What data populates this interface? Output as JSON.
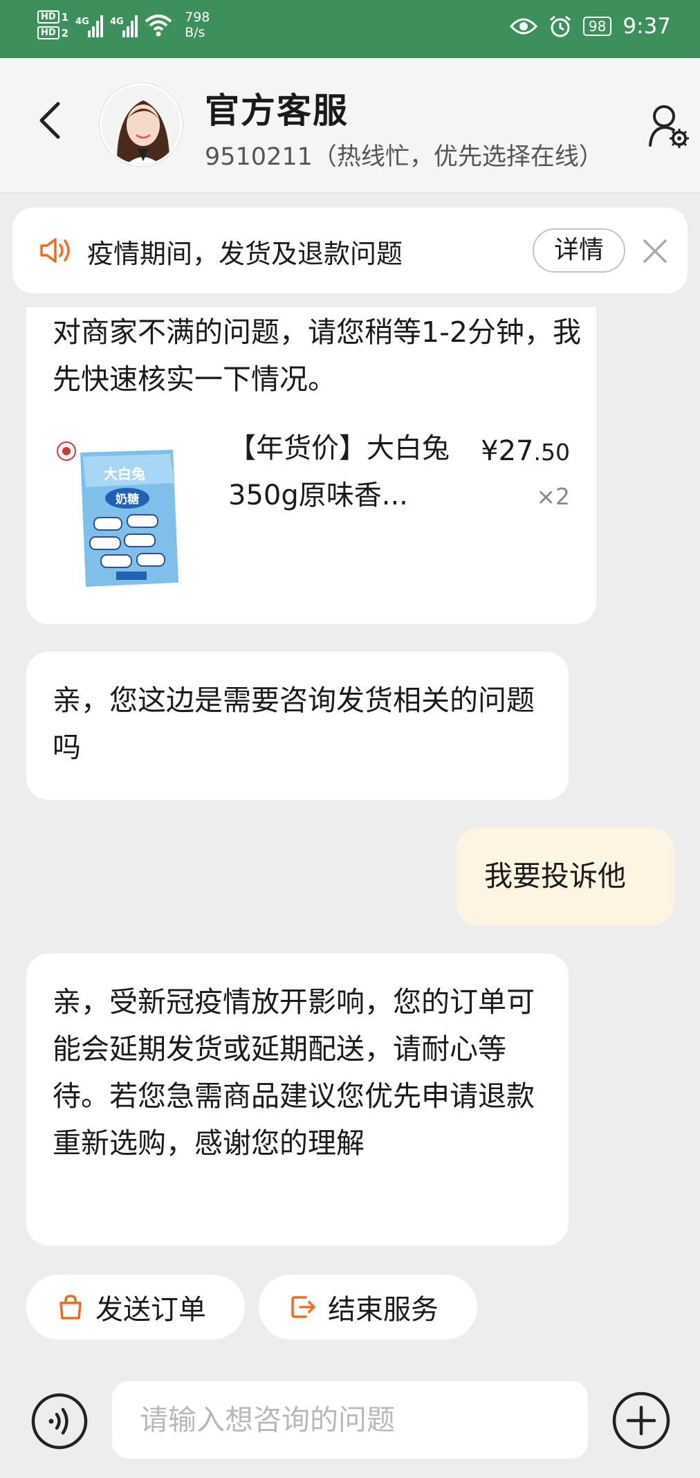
{
  "status_bar": {
    "hd1": "HD",
    "sim1": "1",
    "hd2": "HD",
    "sim2": "2",
    "net1": "4G",
    "net2": "4G",
    "speed_value": "798",
    "speed_unit": "B/s",
    "battery": "98",
    "time": "9:37"
  },
  "header": {
    "title": "官方客服",
    "subtitle": "9510211（热线忙，优先选择在线）"
  },
  "notice": {
    "text": "疫情期间，发货及退款问题",
    "detail_label": "详情"
  },
  "messages": {
    "m1_text": "对商家不满的问题，请您稍等1-2分钟，我先快速核实一下情况。",
    "product": {
      "name": "【年货价】大白兔350g原味香...",
      "price_symbol": "¥",
      "price_int": "27",
      "price_dec": ".50",
      "qty": "×2"
    },
    "m2_text": "亲，您这边是需要咨询发货相关的问题吗",
    "m3_text": "我要投诉他",
    "m4_text": "亲，受新冠疫情放开影响，您的订单可能会延期发货或延期配送，请耐心等待。若您急需商品建议您优先申请退款重新选购，感谢您的理解"
  },
  "actions": {
    "send_order": "发送订单",
    "end_service": "结束服务"
  },
  "input": {
    "placeholder": "请输入想咨询的问题"
  },
  "colors": {
    "status_bar_bg": "#3d8f5b",
    "accent_orange": "#f26b21",
    "user_bubble_bg": "#fdf4e2",
    "page_bg": "#ededed"
  },
  "icons": [
    "back-arrow-icon",
    "agent-settings-icon",
    "speaker-icon",
    "close-icon",
    "shopping-bag-icon",
    "exit-icon",
    "voice-icon",
    "plus-icon",
    "eye-icon",
    "alarm-icon",
    "wifi-icon",
    "signal-icon"
  ]
}
